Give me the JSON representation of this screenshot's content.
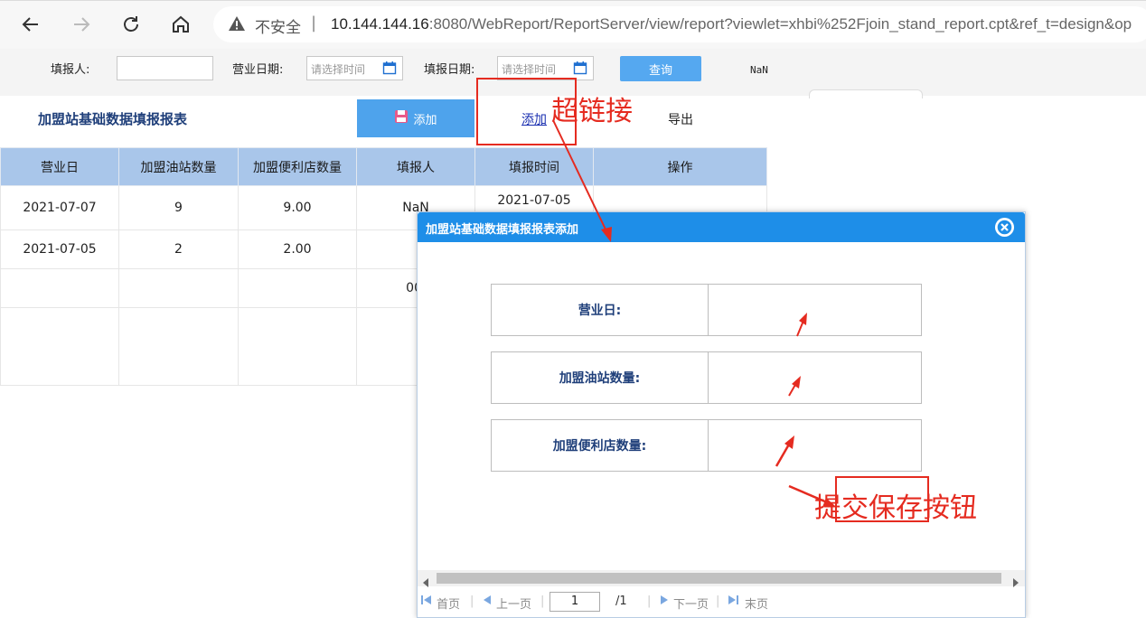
{
  "browser": {
    "insecure_label": "不安全",
    "url_host": "10.144.144.16",
    "url_rest": ":8080/WebReport/ReportServer/view/report?viewlet=xhbi%252Fjoin_stand_report.cpt&ref_t=design&op"
  },
  "filter": {
    "reporter_label": "填报人:",
    "business_date_label": "营业日期:",
    "fill_date_label": "填报日期:",
    "date_placeholder": "请选择时间",
    "query_label": "查询",
    "nan": "NaN"
  },
  "report": {
    "title": "加盟站基础数据填报报表",
    "add_button": "添加",
    "add_link": "添加",
    "export": "导出",
    "columns": [
      "营业日",
      "加盟油站数量",
      "加盟便利店数量",
      "填报人",
      "填报时间",
      "操作"
    ],
    "rows": [
      [
        "2021-07-07",
        "9",
        "9.00",
        "NaN",
        "2021-07-05 16:03:07",
        ""
      ],
      [
        "2021-07-05",
        "2",
        "2.00",
        "",
        "",
        ""
      ],
      [
        "",
        "",
        "",
        "00",
        "",
        ""
      ]
    ]
  },
  "dialog": {
    "title": "加盟站基础数据填报报表添加",
    "fields": [
      "营业日:",
      "加盟油站数量:",
      "加盟便利店数量:"
    ],
    "pager": {
      "first": "首页",
      "prev": "上一页",
      "page": "1",
      "total": "/1",
      "next": "下一页",
      "last": "末页"
    }
  },
  "annotations": {
    "hyperlink": "超链接",
    "submit_save": "提交保存按钮"
  },
  "colors": {
    "accent": "#1e8ee8",
    "header_fill": "#a9c6ea",
    "annotation": "#e52b20"
  }
}
